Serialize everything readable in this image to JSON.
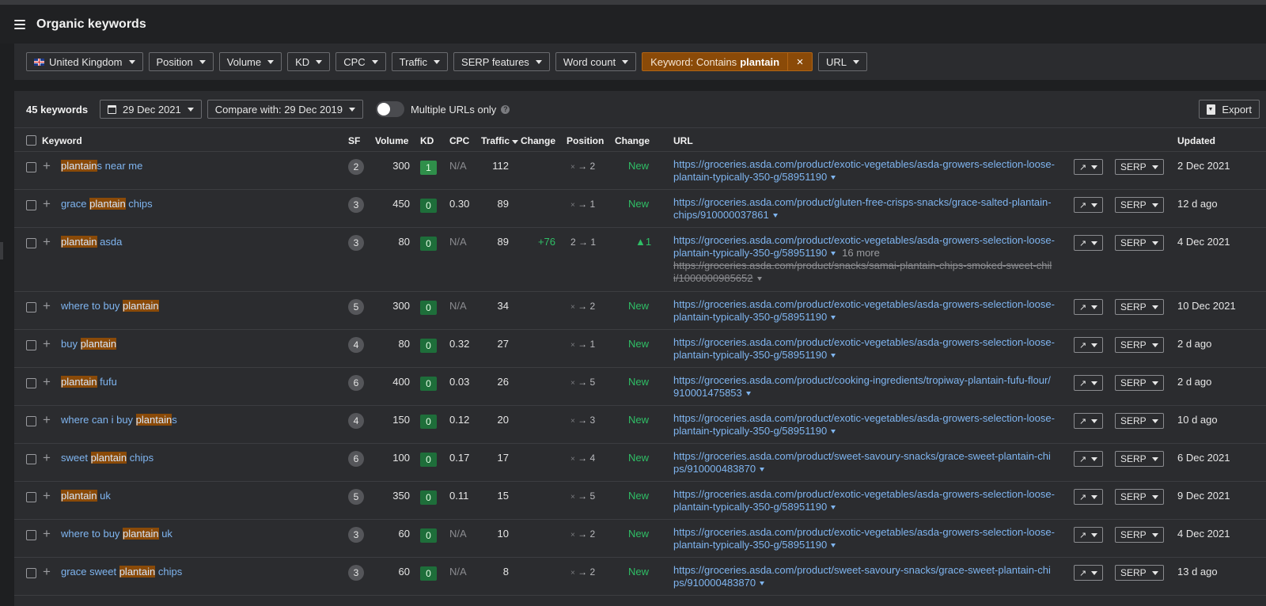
{
  "header": {
    "title": "Organic keywords"
  },
  "filters": [
    {
      "label": "United Kingdom",
      "has_flag": true
    },
    {
      "label": "Position"
    },
    {
      "label": "Volume"
    },
    {
      "label": "KD"
    },
    {
      "label": "CPC"
    },
    {
      "label": "Traffic"
    },
    {
      "label": "SERP features"
    },
    {
      "label": "Word count"
    }
  ],
  "keyword_filter": {
    "prefix": "Keyword: Contains",
    "term": "plantain",
    "close_icon": "×"
  },
  "url_filter": {
    "label": "URL"
  },
  "toolbar": {
    "count": "45 keywords",
    "date": "29 Dec 2021",
    "compare": "Compare with: 29 Dec 2019",
    "toggle_label": "Multiple URLs only",
    "help": "?",
    "export": "Export"
  },
  "columns": {
    "keyword": "Keyword",
    "sf": "SF",
    "volume": "Volume",
    "kd": "KD",
    "cpc": "CPC",
    "traffic": "Traffic",
    "traffic_change": "Change",
    "position": "Position",
    "position_change": "Change",
    "url": "URL",
    "updated": "Updated"
  },
  "rows": [
    {
      "kw": [
        "",
        "plantain",
        "s near me"
      ],
      "sf": "2",
      "volume": "300",
      "kd": "1",
      "cpc": "N/A",
      "traffic": "112",
      "tchange": "",
      "from": "×",
      "to": "2",
      "pchange": "New",
      "url1": "https://groceries.asda.com/product/exotic-vegetables/asda-growers-selection-loose-",
      "url2": "plantain-typically-350-g/58951190",
      "more": "",
      "extra1": "",
      "extra2": "",
      "updated": "2 Dec 2021"
    },
    {
      "kw": [
        "grace ",
        "plantain",
        " chips"
      ],
      "sf": "3",
      "volume": "450",
      "kd": "0",
      "cpc": "0.30",
      "traffic": "89",
      "tchange": "",
      "from": "×",
      "to": "1",
      "pchange": "New",
      "url1": "https://groceries.asda.com/product/gluten-free-crisps-snacks/grace-salted-plantain-",
      "url2": "chips/910000037861",
      "more": "",
      "extra1": "",
      "extra2": "",
      "updated": "12 d ago"
    },
    {
      "kw": [
        "",
        "plantain",
        " asda"
      ],
      "sf": "3",
      "volume": "80",
      "kd": "0",
      "cpc": "N/A",
      "traffic": "89",
      "tchange": "+76",
      "from": "2",
      "to": "1",
      "pchange": "▲1",
      "url1": "https://groceries.asda.com/product/exotic-vegetables/asda-growers-selection-loose-",
      "url2": "plantain-typically-350-g/58951190",
      "more": "16 more",
      "extra1": "https://groceries.asda.com/product/snacks/samai-plantain-chips-smoked-sweet-chil",
      "extra2": "i/1000000985652",
      "updated": "4 Dec 2021"
    },
    {
      "kw": [
        "where to buy ",
        "plantain",
        ""
      ],
      "sf": "5",
      "volume": "300",
      "kd": "0",
      "cpc": "N/A",
      "traffic": "34",
      "tchange": "",
      "from": "×",
      "to": "2",
      "pchange": "New",
      "url1": "https://groceries.asda.com/product/exotic-vegetables/asda-growers-selection-loose-",
      "url2": "plantain-typically-350-g/58951190",
      "more": "",
      "extra1": "",
      "extra2": "",
      "updated": "10 Dec 2021"
    },
    {
      "kw": [
        "buy ",
        "plantain",
        ""
      ],
      "sf": "4",
      "volume": "80",
      "kd": "0",
      "cpc": "0.32",
      "traffic": "27",
      "tchange": "",
      "from": "×",
      "to": "1",
      "pchange": "New",
      "url1": "https://groceries.asda.com/product/exotic-vegetables/asda-growers-selection-loose-",
      "url2": "plantain-typically-350-g/58951190",
      "more": "",
      "extra1": "",
      "extra2": "",
      "updated": "2 d ago"
    },
    {
      "kw": [
        "",
        "plantain",
        " fufu"
      ],
      "sf": "6",
      "volume": "400",
      "kd": "0",
      "cpc": "0.03",
      "traffic": "26",
      "tchange": "",
      "from": "×",
      "to": "5",
      "pchange": "New",
      "url1": "https://groceries.asda.com/product/cooking-ingredients/tropiway-plantain-fufu-flour/",
      "url2": "910001475853",
      "more": "",
      "extra1": "",
      "extra2": "",
      "updated": "2 d ago"
    },
    {
      "kw": [
        "where can i buy ",
        "plantain",
        "s"
      ],
      "sf": "4",
      "volume": "150",
      "kd": "0",
      "cpc": "0.12",
      "traffic": "20",
      "tchange": "",
      "from": "×",
      "to": "3",
      "pchange": "New",
      "url1": "https://groceries.asda.com/product/exotic-vegetables/asda-growers-selection-loose-",
      "url2": "plantain-typically-350-g/58951190",
      "more": "",
      "extra1": "",
      "extra2": "",
      "updated": "10 d ago"
    },
    {
      "kw": [
        "sweet ",
        "plantain",
        " chips"
      ],
      "sf": "6",
      "volume": "100",
      "kd": "0",
      "cpc": "0.17",
      "traffic": "17",
      "tchange": "",
      "from": "×",
      "to": "4",
      "pchange": "New",
      "url1": "https://groceries.asda.com/product/sweet-savoury-snacks/grace-sweet-plantain-chi",
      "url2": "ps/910000483870",
      "more": "",
      "extra1": "",
      "extra2": "",
      "updated": "6 Dec 2021"
    },
    {
      "kw": [
        "",
        "plantain",
        " uk"
      ],
      "sf": "5",
      "volume": "350",
      "kd": "0",
      "cpc": "0.11",
      "traffic": "15",
      "tchange": "",
      "from": "×",
      "to": "5",
      "pchange": "New",
      "url1": "https://groceries.asda.com/product/exotic-vegetables/asda-growers-selection-loose-",
      "url2": "plantain-typically-350-g/58951190",
      "more": "",
      "extra1": "",
      "extra2": "",
      "updated": "9 Dec 2021"
    },
    {
      "kw": [
        "where to buy ",
        "plantain",
        " uk"
      ],
      "sf": "3",
      "volume": "60",
      "kd": "0",
      "cpc": "N/A",
      "traffic": "10",
      "tchange": "",
      "from": "×",
      "to": "2",
      "pchange": "New",
      "url1": "https://groceries.asda.com/product/exotic-vegetables/asda-growers-selection-loose-",
      "url2": "plantain-typically-350-g/58951190",
      "more": "",
      "extra1": "",
      "extra2": "",
      "updated": "4 Dec 2021"
    },
    {
      "kw": [
        "grace sweet ",
        "plantain",
        " chips"
      ],
      "sf": "3",
      "volume": "60",
      "kd": "0",
      "cpc": "N/A",
      "traffic": "8",
      "tchange": "",
      "from": "×",
      "to": "2",
      "pchange": "New",
      "url1": "https://groceries.asda.com/product/sweet-savoury-snacks/grace-sweet-plantain-chi",
      "url2": "ps/910000483870",
      "more": "",
      "extra1": "",
      "extra2": "",
      "updated": "13 d ago"
    }
  ],
  "row_buttons": {
    "chart_icon": "trend-chart-icon",
    "serp_label": "SERP"
  },
  "colors": {
    "highlight": "#8a4a08",
    "link": "#7fb5f0",
    "positive": "#2fbf66",
    "kd_badge": "#1e6e3a"
  }
}
